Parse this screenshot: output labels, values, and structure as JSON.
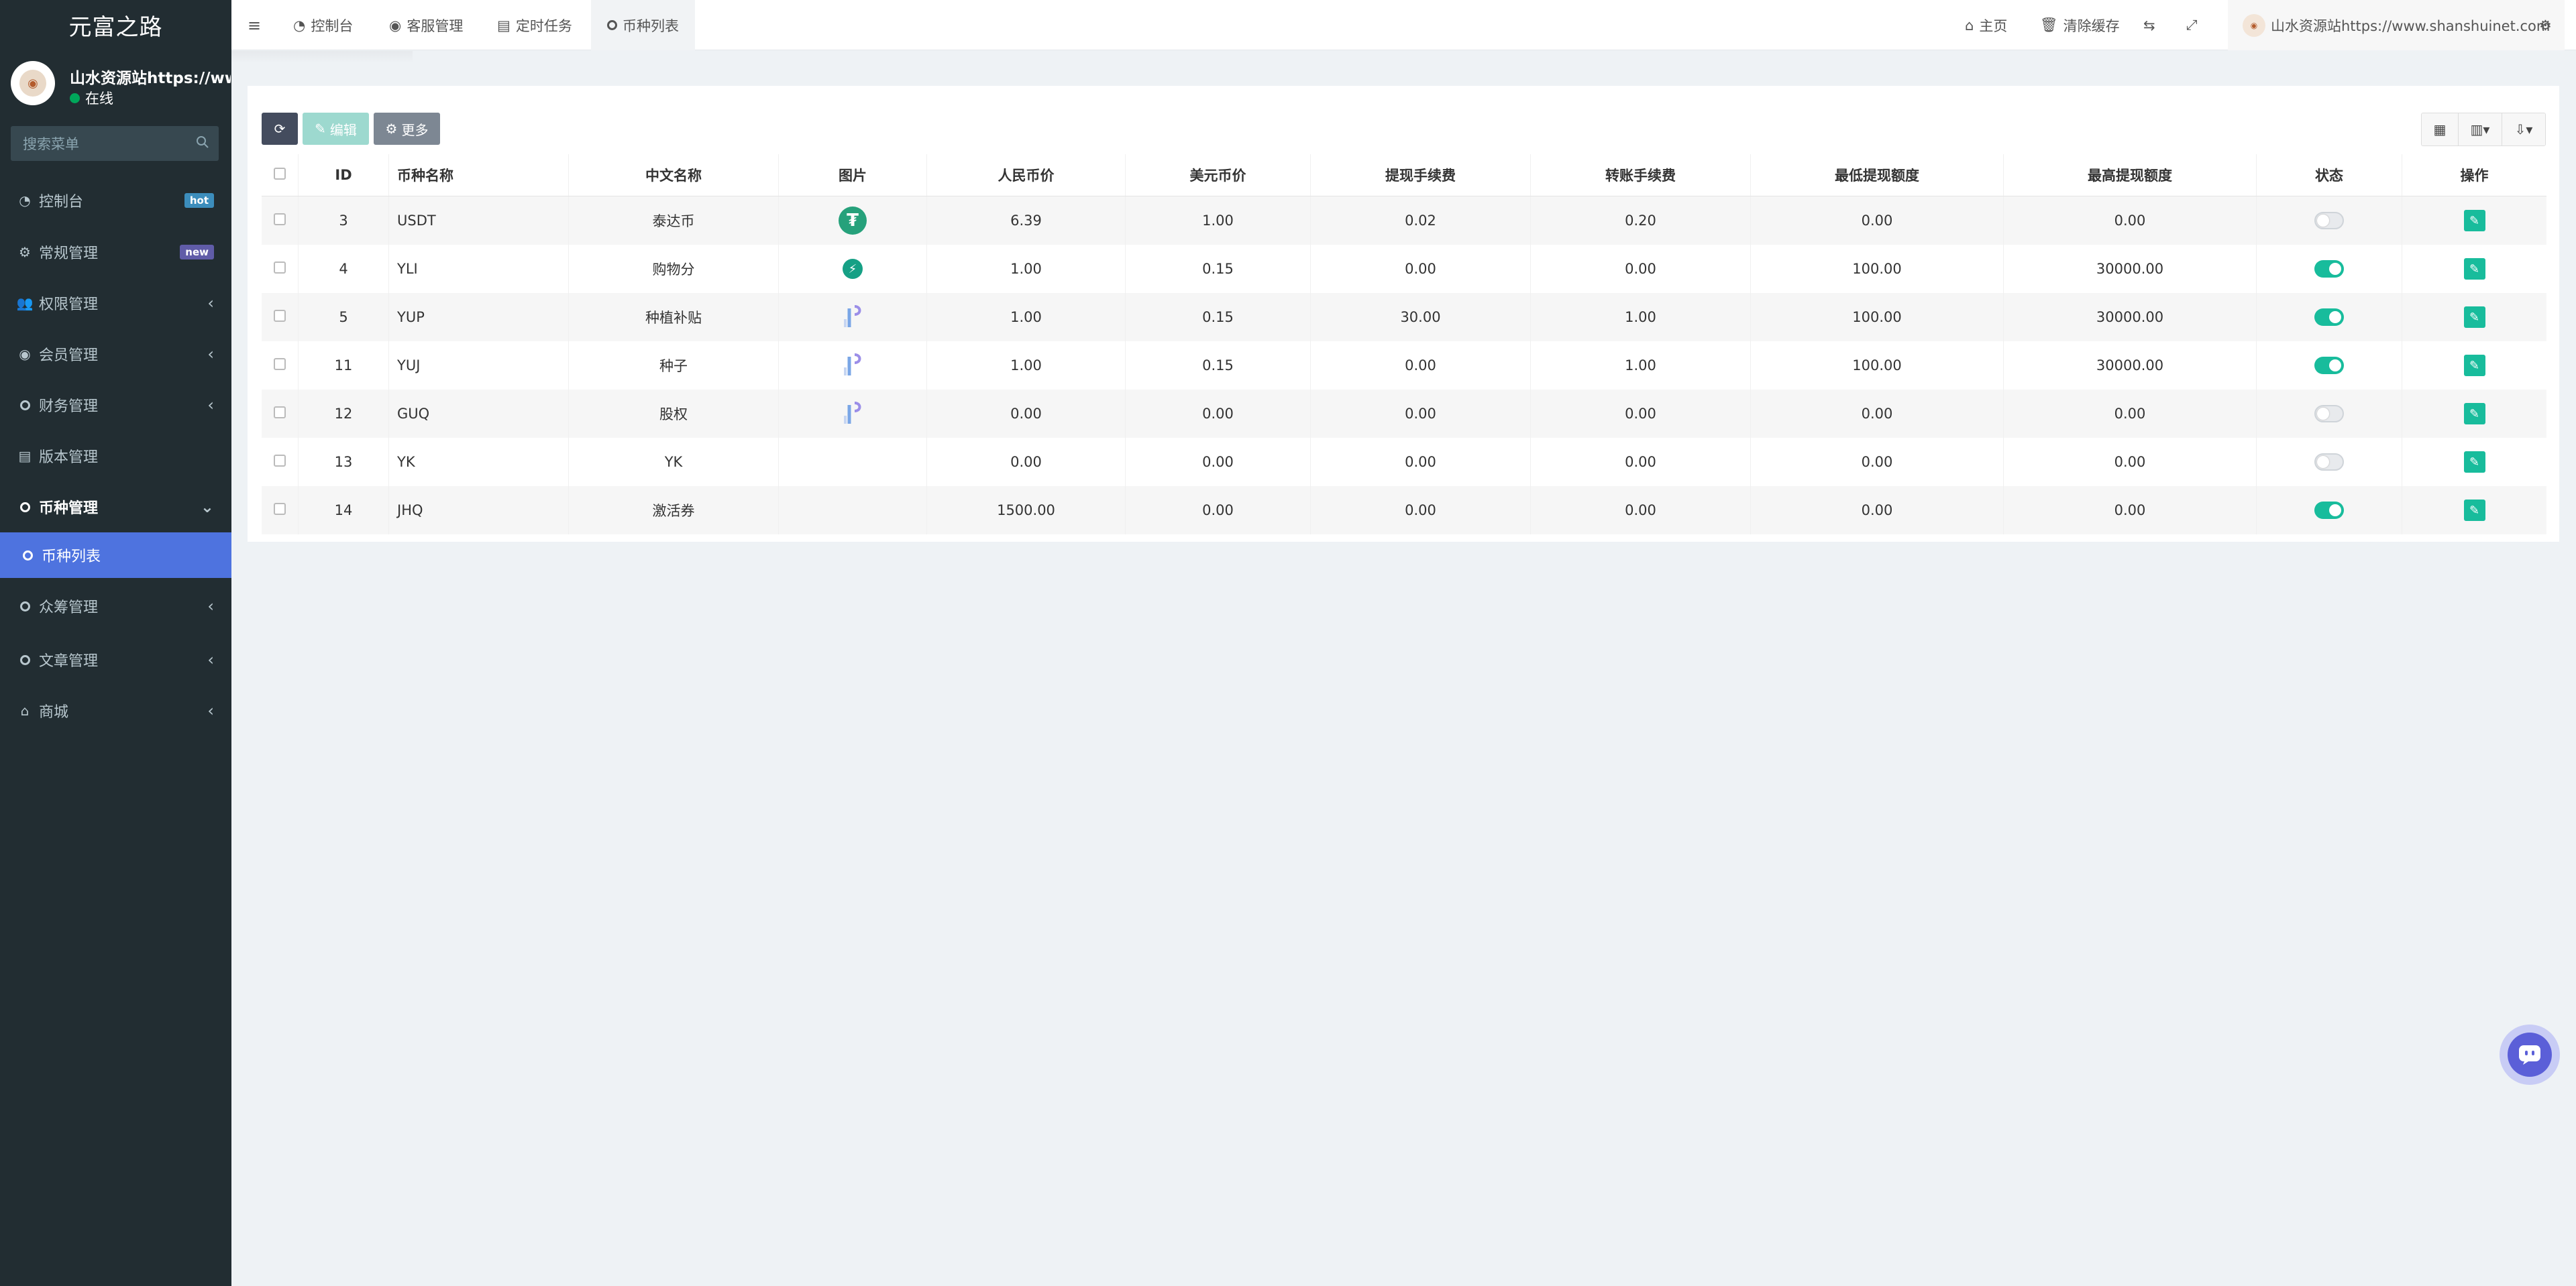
{
  "app": {
    "title": "元富之路"
  },
  "user": {
    "name": "山水资源站https://www.shanshuinet.com",
    "status": "在线"
  },
  "search": {
    "placeholder": "搜索菜单"
  },
  "sidebar": {
    "items": [
      {
        "label": "控制台",
        "icon": "dashboard-icon",
        "badge": "hot"
      },
      {
        "label": "常规管理",
        "icon": "cogs-icon",
        "badge": "new"
      },
      {
        "label": "权限管理",
        "icon": "users-icon"
      },
      {
        "label": "会员管理",
        "icon": "user-circle-icon"
      },
      {
        "label": "财务管理",
        "icon": "circle-icon"
      },
      {
        "label": "版本管理",
        "icon": "file-icon"
      },
      {
        "label": "币种管理",
        "icon": "circle-icon",
        "expanded": true
      },
      {
        "label": "币种列表",
        "icon": "circle-icon",
        "active": true
      },
      {
        "label": "众筹管理",
        "icon": "circle-icon"
      },
      {
        "label": "文章管理",
        "icon": "circle-icon"
      },
      {
        "label": "商城",
        "icon": "home-icon"
      }
    ]
  },
  "tabs": [
    {
      "label": "控制台",
      "icon": "dashboard-icon"
    },
    {
      "label": "客服管理",
      "icon": "user-circle-icon"
    },
    {
      "label": "定时任务",
      "icon": "tasks-icon"
    },
    {
      "label": "币种列表",
      "icon": "circle-icon",
      "active": true
    }
  ],
  "header_right": {
    "home": "主页",
    "clear_cache": "清除缓存",
    "username": "山水资源站https://www.shanshuinet.com"
  },
  "toolbar": {
    "edit": "编辑",
    "more": "更多"
  },
  "table": {
    "columns": [
      "ID",
      "币种名称",
      "中文名称",
      "图片",
      "人民币价",
      "美元币价",
      "提现手续费",
      "转账手续费",
      "最低提现额度",
      "最高提现额度",
      "状态",
      "操作"
    ],
    "rows": [
      {
        "id": "3",
        "name": "USDT",
        "cn": "泰达币",
        "img": "usdt",
        "cny": "6.39",
        "usd": "1.00",
        "wfee": "0.02",
        "tfee": "0.20",
        "min": "0.00",
        "max": "0.00",
        "status": "off"
      },
      {
        "id": "4",
        "name": "YLI",
        "cn": "购物分",
        "img": "bolt",
        "cny": "1.00",
        "usd": "0.15",
        "wfee": "0.00",
        "tfee": "0.00",
        "min": "100.00",
        "max": "30000.00",
        "status": "on"
      },
      {
        "id": "5",
        "name": "YUP",
        "cn": "种植补贴",
        "img": "p",
        "cny": "1.00",
        "usd": "0.15",
        "wfee": "30.00",
        "tfee": "1.00",
        "min": "100.00",
        "max": "30000.00",
        "status": "on"
      },
      {
        "id": "11",
        "name": "YUJ",
        "cn": "种子",
        "img": "p",
        "cny": "1.00",
        "usd": "0.15",
        "wfee": "0.00",
        "tfee": "1.00",
        "min": "100.00",
        "max": "30000.00",
        "status": "on"
      },
      {
        "id": "12",
        "name": "GUQ",
        "cn": "股权",
        "img": "p",
        "cny": "0.00",
        "usd": "0.00",
        "wfee": "0.00",
        "tfee": "0.00",
        "min": "0.00",
        "max": "0.00",
        "status": "off"
      },
      {
        "id": "13",
        "name": "YK",
        "cn": "YK",
        "img": "",
        "cny": "0.00",
        "usd": "0.00",
        "wfee": "0.00",
        "tfee": "0.00",
        "min": "0.00",
        "max": "0.00",
        "status": "off"
      },
      {
        "id": "14",
        "name": "JHQ",
        "cn": "激活券",
        "img": "",
        "cny": "1500.00",
        "usd": "0.00",
        "wfee": "0.00",
        "tfee": "0.00",
        "min": "0.00",
        "max": "0.00",
        "status": "on"
      }
    ]
  },
  "colors": {
    "sidebar_bg": "#222d32",
    "active_menu": "#4e73df",
    "accent": "#18bc9c",
    "hot": "#3c8dbc",
    "new": "#605ca8"
  }
}
